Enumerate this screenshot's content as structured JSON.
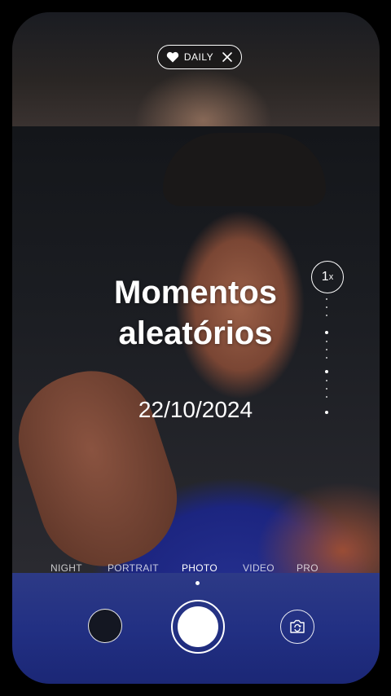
{
  "header": {
    "daily_label": "DAILY",
    "heart_icon": "heart-icon",
    "close_icon": "close-icon"
  },
  "overlay": {
    "title_line1": "Momentos",
    "title_line2": "aleatórios",
    "date": "22/10/2024"
  },
  "zoom": {
    "value": "1",
    "unit": "x"
  },
  "modes": [
    {
      "label": "NIGHT",
      "active": false
    },
    {
      "label": "PORTRAIT",
      "active": false
    },
    {
      "label": "PHOTO",
      "active": true
    },
    {
      "label": "VIDEO",
      "active": false
    },
    {
      "label": "PRO",
      "active": false
    }
  ],
  "controls": {
    "gallery_icon": "gallery-thumbnail",
    "shutter_icon": "shutter-button",
    "flip_icon": "flip-camera-icon"
  },
  "colors": {
    "accent": "#ffffff",
    "bottom_bar": "#223083"
  }
}
